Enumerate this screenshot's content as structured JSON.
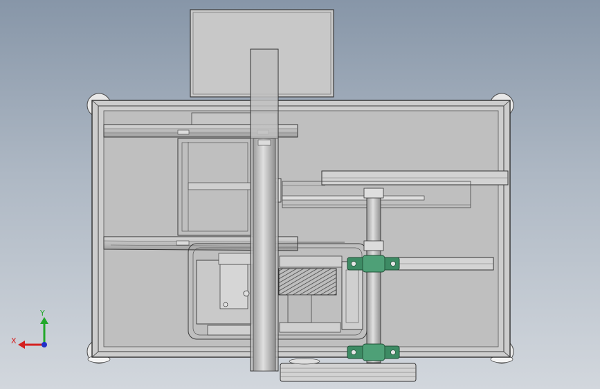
{
  "view": {
    "background_top": "#8796a8",
    "background_bottom": "#d2d7dd",
    "part_fill": "#c4c4c4",
    "part_dark": "#9a9a9a",
    "line_color": "#3a3a3a",
    "bearing_color": "#3d8b64"
  },
  "triad": {
    "x_label": "X",
    "y_label": "Y",
    "x_color": "#d42020",
    "y_color": "#22a82a",
    "z_color": "#2030c8"
  }
}
